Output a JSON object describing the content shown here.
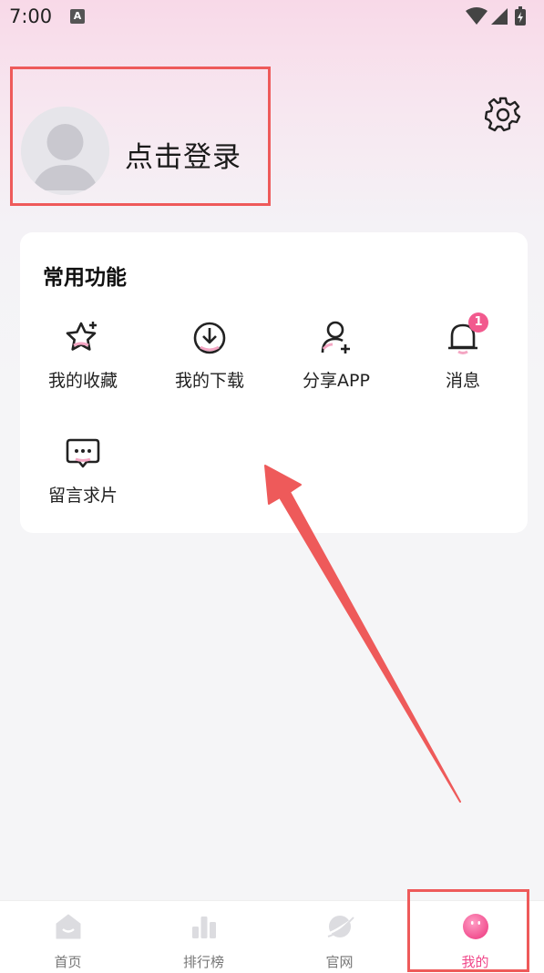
{
  "status": {
    "time": "7:00",
    "notif_icon": "A"
  },
  "profile": {
    "login_label": "点击登录"
  },
  "section": {
    "title": "常用功能"
  },
  "functions": [
    {
      "label": "我的收藏",
      "icon": "star-icon"
    },
    {
      "label": "我的下载",
      "icon": "download-icon"
    },
    {
      "label": "分享APP",
      "icon": "add-user-icon"
    },
    {
      "label": "消息",
      "icon": "bell-icon",
      "badge": "1"
    },
    {
      "label": "留言求片",
      "icon": "chat-icon"
    }
  ],
  "tabs": [
    {
      "label": "首页",
      "icon": "home-icon"
    },
    {
      "label": "排行榜",
      "icon": "rank-icon"
    },
    {
      "label": "官网",
      "icon": "planet-icon"
    },
    {
      "label": "我的",
      "icon": "profile-icon",
      "active": true
    }
  ],
  "colors": {
    "accent": "#f0488a",
    "highlight": "#ee5a5a",
    "badge": "#f25a8e"
  }
}
